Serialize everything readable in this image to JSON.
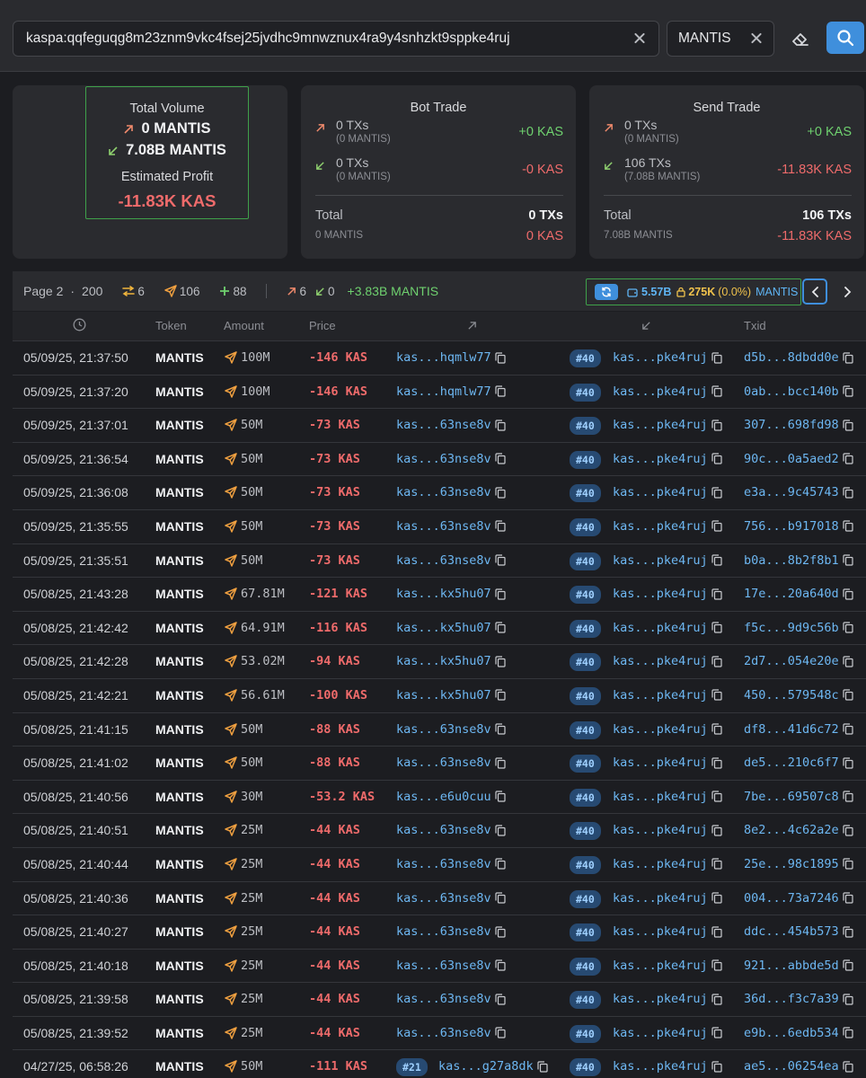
{
  "search": {
    "address": "kaspa:qqfeguqg8m23znm9vkc4fsej25jvdhc9mnwznux4ra9y4snhzkt9sppke4ruj",
    "token": "MANTIS"
  },
  "summary": {
    "total_volume_label": "Total Volume",
    "in_volume": "0 MANTIS",
    "out_volume": "7.08B MANTIS",
    "estimated_profit_label": "Estimated Profit",
    "estimated_profit": "-11.83K KAS"
  },
  "bot_trade": {
    "title": "Bot Trade",
    "buy_txs": "0 TXs",
    "buy_sub": "(0 MANTIS)",
    "buy_kas": "+0 KAS",
    "sell_txs": "0 TXs",
    "sell_sub": "(0 MANTIS)",
    "sell_kas": "-0 KAS",
    "total_label": "Total",
    "total_txs": "0 TXs",
    "total_sub": "0 MANTIS",
    "total_kas": "0 KAS"
  },
  "send_trade": {
    "title": "Send Trade",
    "buy_txs": "0 TXs",
    "buy_sub": "(0 MANTIS)",
    "buy_kas": "+0 KAS",
    "sell_txs": "106 TXs",
    "sell_sub": "(7.08B MANTIS)",
    "sell_kas": "-11.83K KAS",
    "total_label": "Total",
    "total_txs": "106 TXs",
    "total_sub": "7.08B MANTIS",
    "total_kas": "-11.83K KAS"
  },
  "pager": {
    "page": "Page 2",
    "dot": "·",
    "per_page": "200",
    "swap_count": "6",
    "send_count": "106",
    "plus_count": "88",
    "out_count": "6",
    "in_count": "0",
    "net": "+3.83B MANTIS",
    "pool_balance": "5.57B",
    "pool_locked": "275K",
    "pool_pct": "(0.0%)",
    "pool_token": "MANTIS"
  },
  "table": {
    "headers": {
      "token": "Token",
      "amount": "Amount",
      "price": "Price",
      "txid": "Txid"
    },
    "rows": [
      {
        "time": "05/09/25, 21:37:50",
        "token": "MANTIS",
        "amount": "100M",
        "price": "-146 KAS",
        "from": "kas...hqmlw77",
        "from_tag": "",
        "to_tag": "#40",
        "to": "kas...pke4ruj",
        "txid": "d5b...8dbdd0e"
      },
      {
        "time": "05/09/25, 21:37:20",
        "token": "MANTIS",
        "amount": "100M",
        "price": "-146 KAS",
        "from": "kas...hqmlw77",
        "from_tag": "",
        "to_tag": "#40",
        "to": "kas...pke4ruj",
        "txid": "0ab...bcc140b"
      },
      {
        "time": "05/09/25, 21:37:01",
        "token": "MANTIS",
        "amount": "50M",
        "price": "-73 KAS",
        "from": "kas...63nse8v",
        "from_tag": "",
        "to_tag": "#40",
        "to": "kas...pke4ruj",
        "txid": "307...698fd98"
      },
      {
        "time": "05/09/25, 21:36:54",
        "token": "MANTIS",
        "amount": "50M",
        "price": "-73 KAS",
        "from": "kas...63nse8v",
        "from_tag": "",
        "to_tag": "#40",
        "to": "kas...pke4ruj",
        "txid": "90c...0a5aed2"
      },
      {
        "time": "05/09/25, 21:36:08",
        "token": "MANTIS",
        "amount": "50M",
        "price": "-73 KAS",
        "from": "kas...63nse8v",
        "from_tag": "",
        "to_tag": "#40",
        "to": "kas...pke4ruj",
        "txid": "e3a...9c45743"
      },
      {
        "time": "05/09/25, 21:35:55",
        "token": "MANTIS",
        "amount": "50M",
        "price": "-73 KAS",
        "from": "kas...63nse8v",
        "from_tag": "",
        "to_tag": "#40",
        "to": "kas...pke4ruj",
        "txid": "756...b917018"
      },
      {
        "time": "05/09/25, 21:35:51",
        "token": "MANTIS",
        "amount": "50M",
        "price": "-73 KAS",
        "from": "kas...63nse8v",
        "from_tag": "",
        "to_tag": "#40",
        "to": "kas...pke4ruj",
        "txid": "b0a...8b2f8b1"
      },
      {
        "time": "05/08/25, 21:43:28",
        "token": "MANTIS",
        "amount": "67.81M",
        "price": "-121 KAS",
        "from": "kas...kx5hu07",
        "from_tag": "",
        "to_tag": "#40",
        "to": "kas...pke4ruj",
        "txid": "17e...20a640d"
      },
      {
        "time": "05/08/25, 21:42:42",
        "token": "MANTIS",
        "amount": "64.91M",
        "price": "-116 KAS",
        "from": "kas...kx5hu07",
        "from_tag": "",
        "to_tag": "#40",
        "to": "kas...pke4ruj",
        "txid": "f5c...9d9c56b"
      },
      {
        "time": "05/08/25, 21:42:28",
        "token": "MANTIS",
        "amount": "53.02M",
        "price": "-94 KAS",
        "from": "kas...kx5hu07",
        "from_tag": "",
        "to_tag": "#40",
        "to": "kas...pke4ruj",
        "txid": "2d7...054e20e"
      },
      {
        "time": "05/08/25, 21:42:21",
        "token": "MANTIS",
        "amount": "56.61M",
        "price": "-100 KAS",
        "from": "kas...kx5hu07",
        "from_tag": "",
        "to_tag": "#40",
        "to": "kas...pke4ruj",
        "txid": "450...579548c"
      },
      {
        "time": "05/08/25, 21:41:15",
        "token": "MANTIS",
        "amount": "50M",
        "price": "-88 KAS",
        "from": "kas...63nse8v",
        "from_tag": "",
        "to_tag": "#40",
        "to": "kas...pke4ruj",
        "txid": "df8...41d6c72"
      },
      {
        "time": "05/08/25, 21:41:02",
        "token": "MANTIS",
        "amount": "50M",
        "price": "-88 KAS",
        "from": "kas...63nse8v",
        "from_tag": "",
        "to_tag": "#40",
        "to": "kas...pke4ruj",
        "txid": "de5...210c6f7"
      },
      {
        "time": "05/08/25, 21:40:56",
        "token": "MANTIS",
        "amount": "30M",
        "price": "-53.2 KAS",
        "from": "kas...e6u0cuu",
        "from_tag": "",
        "to_tag": "#40",
        "to": "kas...pke4ruj",
        "txid": "7be...69507c8"
      },
      {
        "time": "05/08/25, 21:40:51",
        "token": "MANTIS",
        "amount": "25M",
        "price": "-44 KAS",
        "from": "kas...63nse8v",
        "from_tag": "",
        "to_tag": "#40",
        "to": "kas...pke4ruj",
        "txid": "8e2...4c62a2e"
      },
      {
        "time": "05/08/25, 21:40:44",
        "token": "MANTIS",
        "amount": "25M",
        "price": "-44 KAS",
        "from": "kas...63nse8v",
        "from_tag": "",
        "to_tag": "#40",
        "to": "kas...pke4ruj",
        "txid": "25e...98c1895"
      },
      {
        "time": "05/08/25, 21:40:36",
        "token": "MANTIS",
        "amount": "25M",
        "price": "-44 KAS",
        "from": "kas...63nse8v",
        "from_tag": "",
        "to_tag": "#40",
        "to": "kas...pke4ruj",
        "txid": "004...73a7246"
      },
      {
        "time": "05/08/25, 21:40:27",
        "token": "MANTIS",
        "amount": "25M",
        "price": "-44 KAS",
        "from": "kas...63nse8v",
        "from_tag": "",
        "to_tag": "#40",
        "to": "kas...pke4ruj",
        "txid": "ddc...454b573"
      },
      {
        "time": "05/08/25, 21:40:18",
        "token": "MANTIS",
        "amount": "25M",
        "price": "-44 KAS",
        "from": "kas...63nse8v",
        "from_tag": "",
        "to_tag": "#40",
        "to": "kas...pke4ruj",
        "txid": "921...abbde5d"
      },
      {
        "time": "05/08/25, 21:39:58",
        "token": "MANTIS",
        "amount": "25M",
        "price": "-44 KAS",
        "from": "kas...63nse8v",
        "from_tag": "",
        "to_tag": "#40",
        "to": "kas...pke4ruj",
        "txid": "36d...f3c7a39"
      },
      {
        "time": "05/08/25, 21:39:52",
        "token": "MANTIS",
        "amount": "25M",
        "price": "-44 KAS",
        "from": "kas...63nse8v",
        "from_tag": "",
        "to_tag": "#40",
        "to": "kas...pke4ruj",
        "txid": "e9b...6edb534"
      },
      {
        "time": "04/27/25, 06:58:26",
        "token": "MANTIS",
        "amount": "50M",
        "price": "-111 KAS",
        "from": "kas...g27a8dk",
        "from_tag": "#21",
        "to_tag": "#40",
        "to": "kas...pke4ruj",
        "txid": "ae5...06254ea"
      }
    ]
  },
  "colors": {
    "accent": "#3f8fdc",
    "positive": "#6fd16f",
    "negative": "#ef6b6b",
    "highlight_border": "#3fa14a",
    "link": "#6db7f2"
  }
}
